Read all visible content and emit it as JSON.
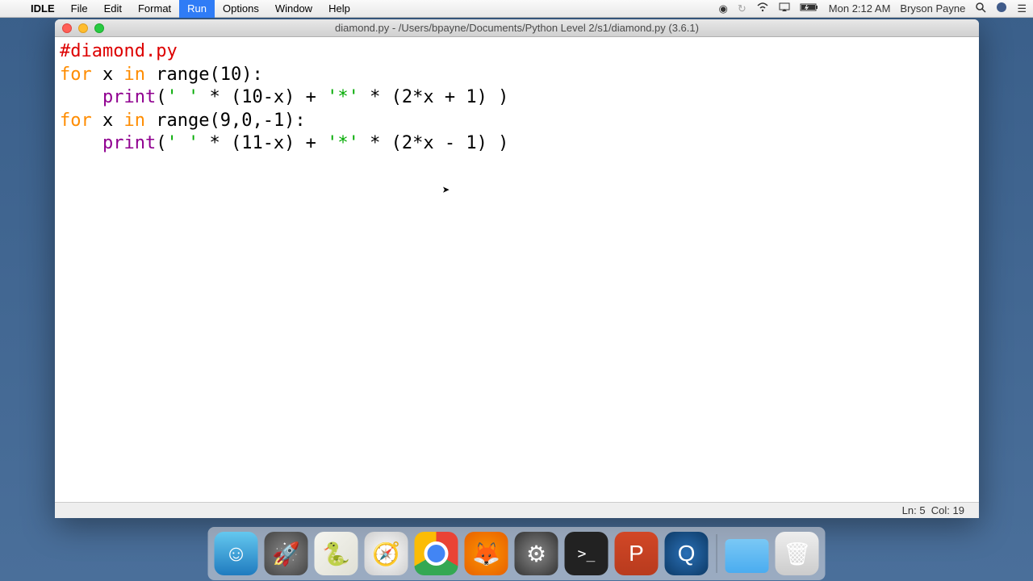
{
  "menubar": {
    "app_name": "IDLE",
    "items": [
      "File",
      "Edit",
      "Format",
      "Run",
      "Options",
      "Window",
      "Help"
    ],
    "active_index": 3,
    "clock": "Mon 2:12 AM",
    "user": "Bryson Payne"
  },
  "window": {
    "title": "diamond.py - /Users/bpayne/Documents/Python Level 2/s1/diamond.py (3.6.1)",
    "status_ln": "Ln: 5",
    "status_col": "Col: 19"
  },
  "code": {
    "line1_comment": "#diamond.py",
    "line2_kw1": "for",
    "line2_var": " x ",
    "line2_kw2": "in",
    "line2_call": " range(10):",
    "line3_indent": "    ",
    "line3_builtin": "print",
    "line3_p1": "(",
    "line3_str1": "' '",
    "line3_mid1": " * (10-x) + ",
    "line3_str2": "'*'",
    "line3_mid2": " * (2*x + 1) )",
    "line4_kw1": "for",
    "line4_var": " x ",
    "line4_kw2": "in",
    "line4_call": " range(9,0,-1):",
    "line5_indent": "    ",
    "line5_builtin": "print",
    "line5_p1": "(",
    "line5_str1": "' '",
    "line5_mid1": " * (11-x) + ",
    "line5_str2": "'*'",
    "line5_mid2": " * (2*x - 1) )"
  },
  "dock": {
    "items": [
      "finder",
      "launchpad",
      "python",
      "safari",
      "chrome",
      "firefox",
      "settings",
      "terminal",
      "powerpoint",
      "quicktime"
    ],
    "right_items": [
      "downloads-folder",
      "trash"
    ]
  }
}
